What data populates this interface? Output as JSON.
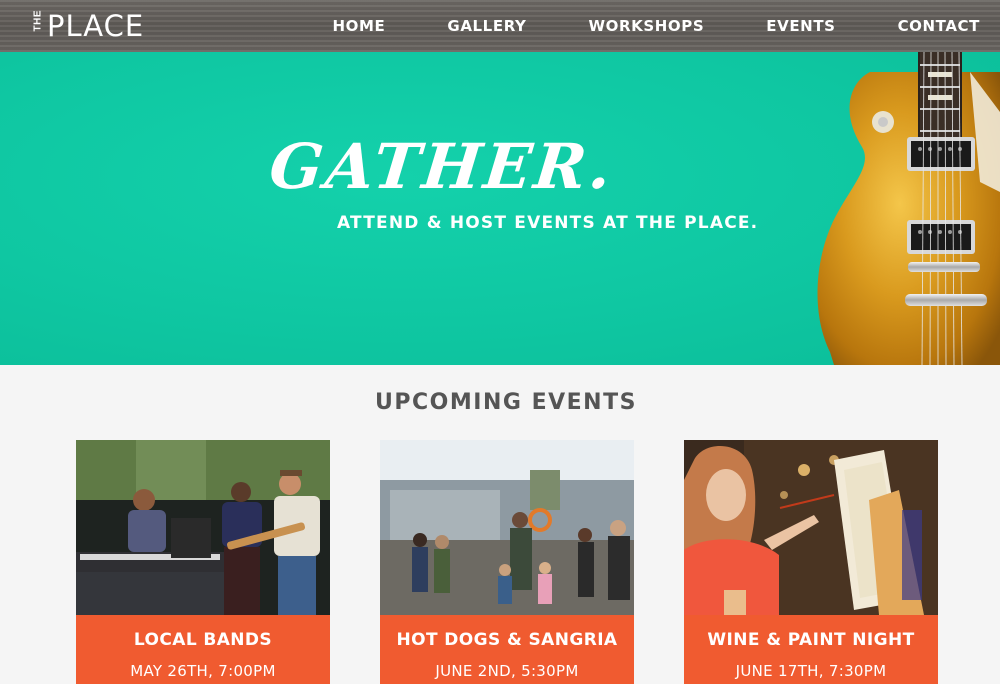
{
  "site": {
    "logo_small": "THE",
    "logo_main": "PLACE"
  },
  "nav": {
    "items": [
      "HOME",
      "GALLERY",
      "WORKSHOPS",
      "EVENTS",
      "CONTACT"
    ]
  },
  "hero": {
    "title": "GATHER.",
    "subtitle": "ATTEND & HOST EVENTS AT THE PLACE.",
    "background_color": "#0fc7a2",
    "image": "gold-electric-guitar"
  },
  "events": {
    "heading": "UPCOMING EVENTS",
    "accent_color": "#f05b30",
    "cards": [
      {
        "name": "LOCAL BANDS",
        "date": "MAY 26TH, 7:00PM",
        "image": "band-performing-photo"
      },
      {
        "name": "HOT DOGS & SANGRIA",
        "date": "JUNE 2ND, 5:30PM",
        "image": "outdoor-gathering-photo"
      },
      {
        "name": "WINE & PAINT NIGHT",
        "date": "JUNE 17TH, 7:30PM",
        "image": "woman-painting-canvas-photo"
      }
    ]
  }
}
